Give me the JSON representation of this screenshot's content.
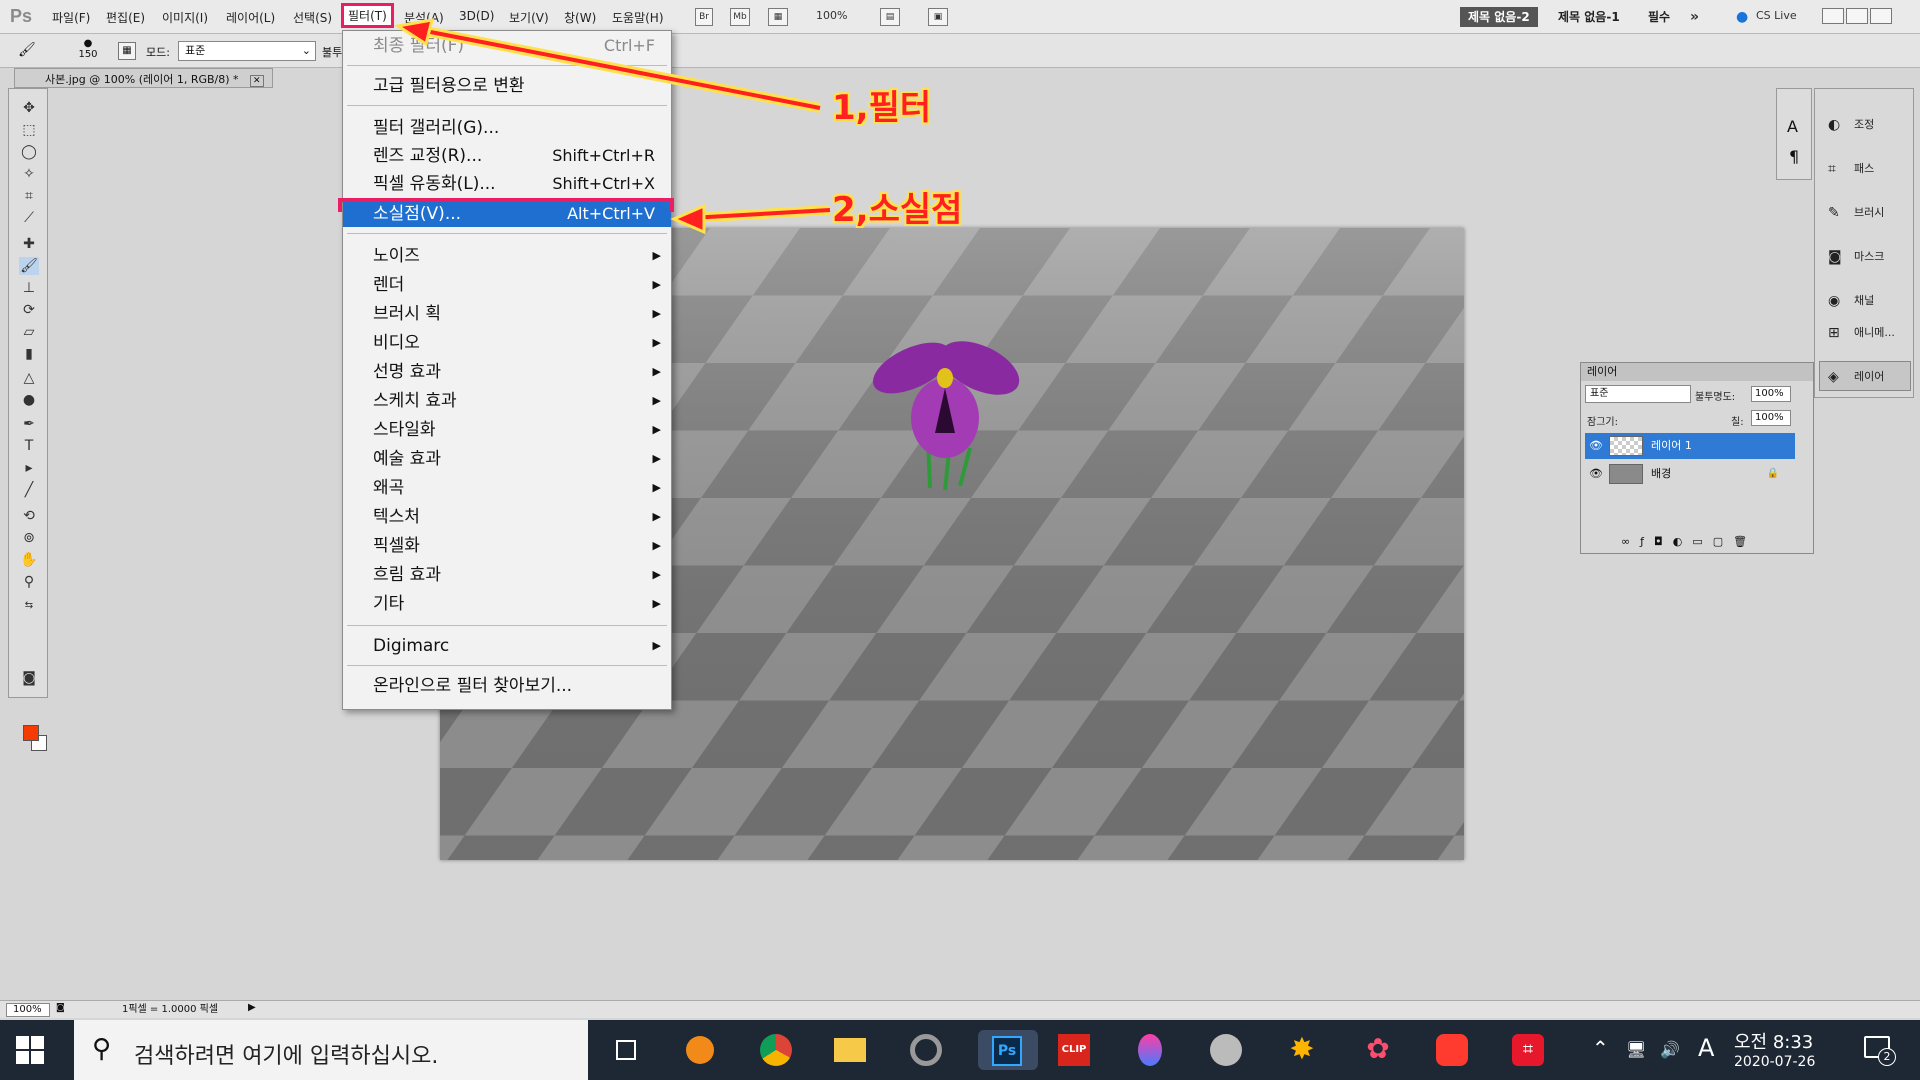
{
  "menubar": {
    "logo": "Ps",
    "items": [
      "파일(F)",
      "편집(E)",
      "이미지(I)",
      "레이어(L)",
      "선택(S)",
      "필터(T)",
      "분석(A)",
      "3D(D)",
      "보기(V)",
      "창(W)",
      "도움말(H)"
    ],
    "bridge_label": "Br",
    "minibridge_label": "Mb",
    "zoom": "100%",
    "workspace_active": "제목 없음-2",
    "workspace_other": "제목 없음-1",
    "essentials": "필수",
    "cs_live": "CS Live"
  },
  "options": {
    "brush_size": "150",
    "mode_label": "모드:",
    "mode_value": "표준",
    "opacity_label": "불투"
  },
  "document": {
    "tab_title": "사본.jpg @ 100% (레이어 1, RGB/8) *"
  },
  "filter_menu": {
    "last_filter": "최종 필터(F)",
    "last_filter_shortcut": "Ctrl+F",
    "convert_smart": "고급 필터용으로 변환",
    "gallery": "필터 갤러리(G)...",
    "lens_correction": "렌즈 교정(R)...",
    "lens_shortcut": "Shift+Ctrl+R",
    "liquify": "픽셀 유동화(L)...",
    "liquify_shortcut": "Shift+Ctrl+X",
    "vanishing_point": "소실점(V)...",
    "vanishing_shortcut": "Alt+Ctrl+V",
    "submenus": [
      "노이즈",
      "렌더",
      "브러시 획",
      "비디오",
      "선명 효과",
      "스케치 효과",
      "스타일화",
      "예술 효과",
      "왜곡",
      "텍스처",
      "픽셀화",
      "흐림 효과",
      "기타"
    ],
    "digimarc": "Digimarc",
    "browse_online": "온라인으로 필터 찾아보기..."
  },
  "annotations": {
    "step1": "1,필터",
    "step2": "2,소실점",
    "color": "#ff2020"
  },
  "dock": {
    "items": [
      "조정",
      "패스",
      "브러시",
      "마스크",
      "채널",
      "애니메...",
      "레이어"
    ]
  },
  "layers_panel": {
    "title": "레이어",
    "blend_mode": "표준",
    "opacity_label": "불투명도:",
    "opacity": "100%",
    "lock_label": "잠그기:",
    "fill_label": "칠:",
    "fill": "100%",
    "layers": [
      {
        "name": "레이어 1",
        "selected": true
      },
      {
        "name": "배경",
        "selected": false
      }
    ]
  },
  "status": {
    "zoom": "100%",
    "info": "1픽셀 = 1.0000 픽셀"
  },
  "taskbar": {
    "search_placeholder": "검색하려면 여기에 입력하십시오.",
    "time": "오전 8:33",
    "date": "2020-07-26",
    "ime": "A",
    "notifications": "2",
    "apps": [
      "task-view",
      "app-s",
      "chrome",
      "file-explorer",
      "photoscape",
      "photoshop",
      "clip",
      "color-app",
      "pro-app",
      "star-app",
      "pin-app",
      "camera-app",
      "crop-app"
    ]
  },
  "colors": {
    "highlight": "#1f6fd1",
    "callout_border": "#e91e63",
    "foreground": "#f53b00"
  }
}
